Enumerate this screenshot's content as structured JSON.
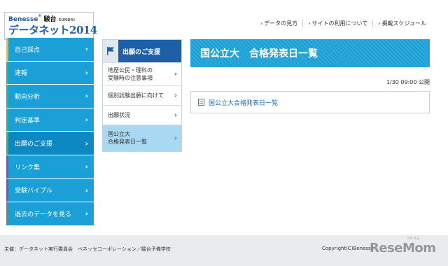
{
  "header": {
    "logo_brand": "Benesse",
    "logo_sundai": "駿台",
    "logo_sundai_en": "SUNDAI",
    "logo_title": "データネット2014",
    "links": [
      "データの見方",
      "サイトの利用について",
      "掲載スケジュール"
    ]
  },
  "leftnav": {
    "items": [
      {
        "label": "自己採点",
        "accent": "#f2c200"
      },
      {
        "label": "速報",
        "accent": "#2eb872"
      },
      {
        "label": "動向分析",
        "accent": "#2eb872"
      },
      {
        "label": "判定基準",
        "accent": "#2eb872"
      },
      {
        "label": "出願のご支援",
        "accent": "#2eb872"
      },
      {
        "label": "リンク集",
        "accent": "#8a4ab8"
      },
      {
        "label": "受験バイブル",
        "accent": "#8a4ab8"
      },
      {
        "label": "過去のデータを見る",
        "accent": "#8a7a6a"
      }
    ]
  },
  "submenu": {
    "title": "出願のご支援",
    "items": [
      {
        "line1": "地歴公民・理科の",
        "line2": "受験時の注意事項"
      },
      {
        "line1": "個別試験出願に向けて",
        "line2": ""
      },
      {
        "line1": "出願状況",
        "line2": ""
      },
      {
        "line1": "国公立大",
        "line2": "合格発表日一覧"
      }
    ]
  },
  "main": {
    "banner_title": "国公立大　合格発表日一覧",
    "published": "1/30 09:00 公開",
    "link_text": "国公立大合格発表日一覧"
  },
  "footer": {
    "left": "主催：データネット実行委員会　ベネッセコーポレーション／駿台予備学校",
    "right": "Copyright(C)Benesse",
    "watermark": "ReseMom",
    "watermark_ruby": "リセマム"
  },
  "colors": {
    "accent_blue": "#1a9fd6",
    "header_blue": "#1e5fa8",
    "active_sub": "#a9d8f2"
  }
}
